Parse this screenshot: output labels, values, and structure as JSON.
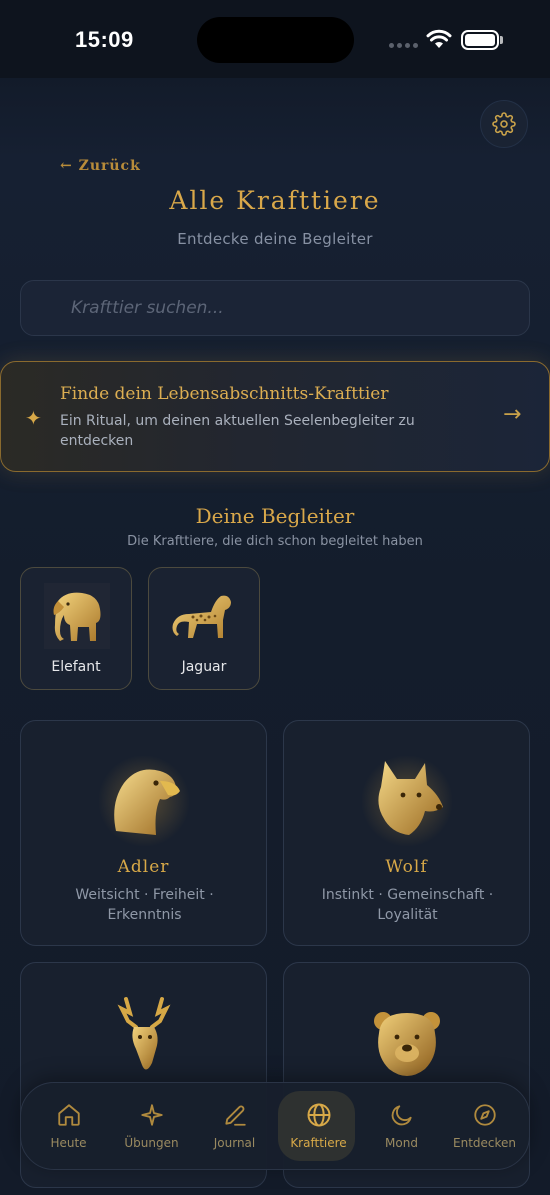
{
  "status_bar": {
    "time": "15:09"
  },
  "header": {
    "back_label": "← Zurück",
    "title": "Alle Krafttiere",
    "subtitle": "Entdecke deine Begleiter"
  },
  "search": {
    "placeholder": "Krafttier suchen...",
    "value": ""
  },
  "ritual_card": {
    "title": "Finde dein Lebensabschnitts-Krafttier",
    "description": "Ein Ritual, um deinen aktuellen Seelenbegleiter zu entdecken",
    "icon": "sparkle-icon",
    "action_icon": "arrow-right-icon"
  },
  "companions": {
    "title": "Deine Begleiter",
    "subtitle": "Die Krafttiere, die dich schon begleitet haben",
    "items": [
      {
        "name": "Elefant"
      },
      {
        "name": "Jaguar"
      }
    ]
  },
  "animals": [
    {
      "name": "Adler",
      "traits": "Weitsicht · Freiheit · Erkenntnis"
    },
    {
      "name": "Wolf",
      "traits": "Instinkt · Gemeinschaft · Loyalität"
    },
    {
      "name": "",
      "traits": ""
    },
    {
      "name": "",
      "traits": ""
    }
  ],
  "tab_bar": {
    "items": [
      {
        "label": "Heute",
        "icon": "home-icon"
      },
      {
        "label": "Übungen",
        "icon": "sparkle-icon"
      },
      {
        "label": "Journal",
        "icon": "pencil-icon"
      },
      {
        "label": "Krafttiere",
        "icon": "globe-icon",
        "active": true
      },
      {
        "label": "Mond",
        "icon": "moon-icon"
      },
      {
        "label": "Entdecken",
        "icon": "compass-icon"
      }
    ]
  },
  "colors": {
    "background": "#141c2a",
    "accent_gold": "#d9a84a",
    "muted_text": "#8f98a7"
  }
}
